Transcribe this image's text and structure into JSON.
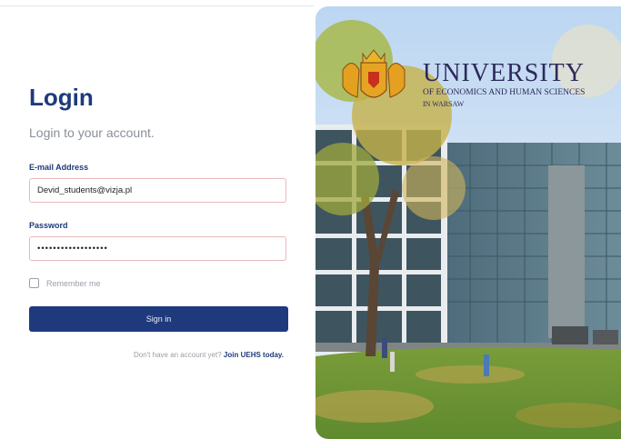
{
  "login": {
    "title": "Login",
    "subtitle": "Login to your account.",
    "email_label": "E-mail Address",
    "email_value": "Devid_students@vizja.pl",
    "password_label": "Password",
    "password_value": "••••••••••••••••••",
    "remember_label": "Remember me",
    "signin_label": "Sign in",
    "signup_prompt": "Don't have an account yet?",
    "signup_link": "Join UEHS today."
  },
  "brand": {
    "name": "UNIVERSITY",
    "line1": "OF ECONOMICS AND HUMAN SCIENCES",
    "line2": "IN WARSAW",
    "crest_icon": "heraldic-lions-crest-icon",
    "color": "#2c2a5a"
  },
  "colors": {
    "primary": "#1f3a7c",
    "field_border": "#e7b9bd"
  }
}
